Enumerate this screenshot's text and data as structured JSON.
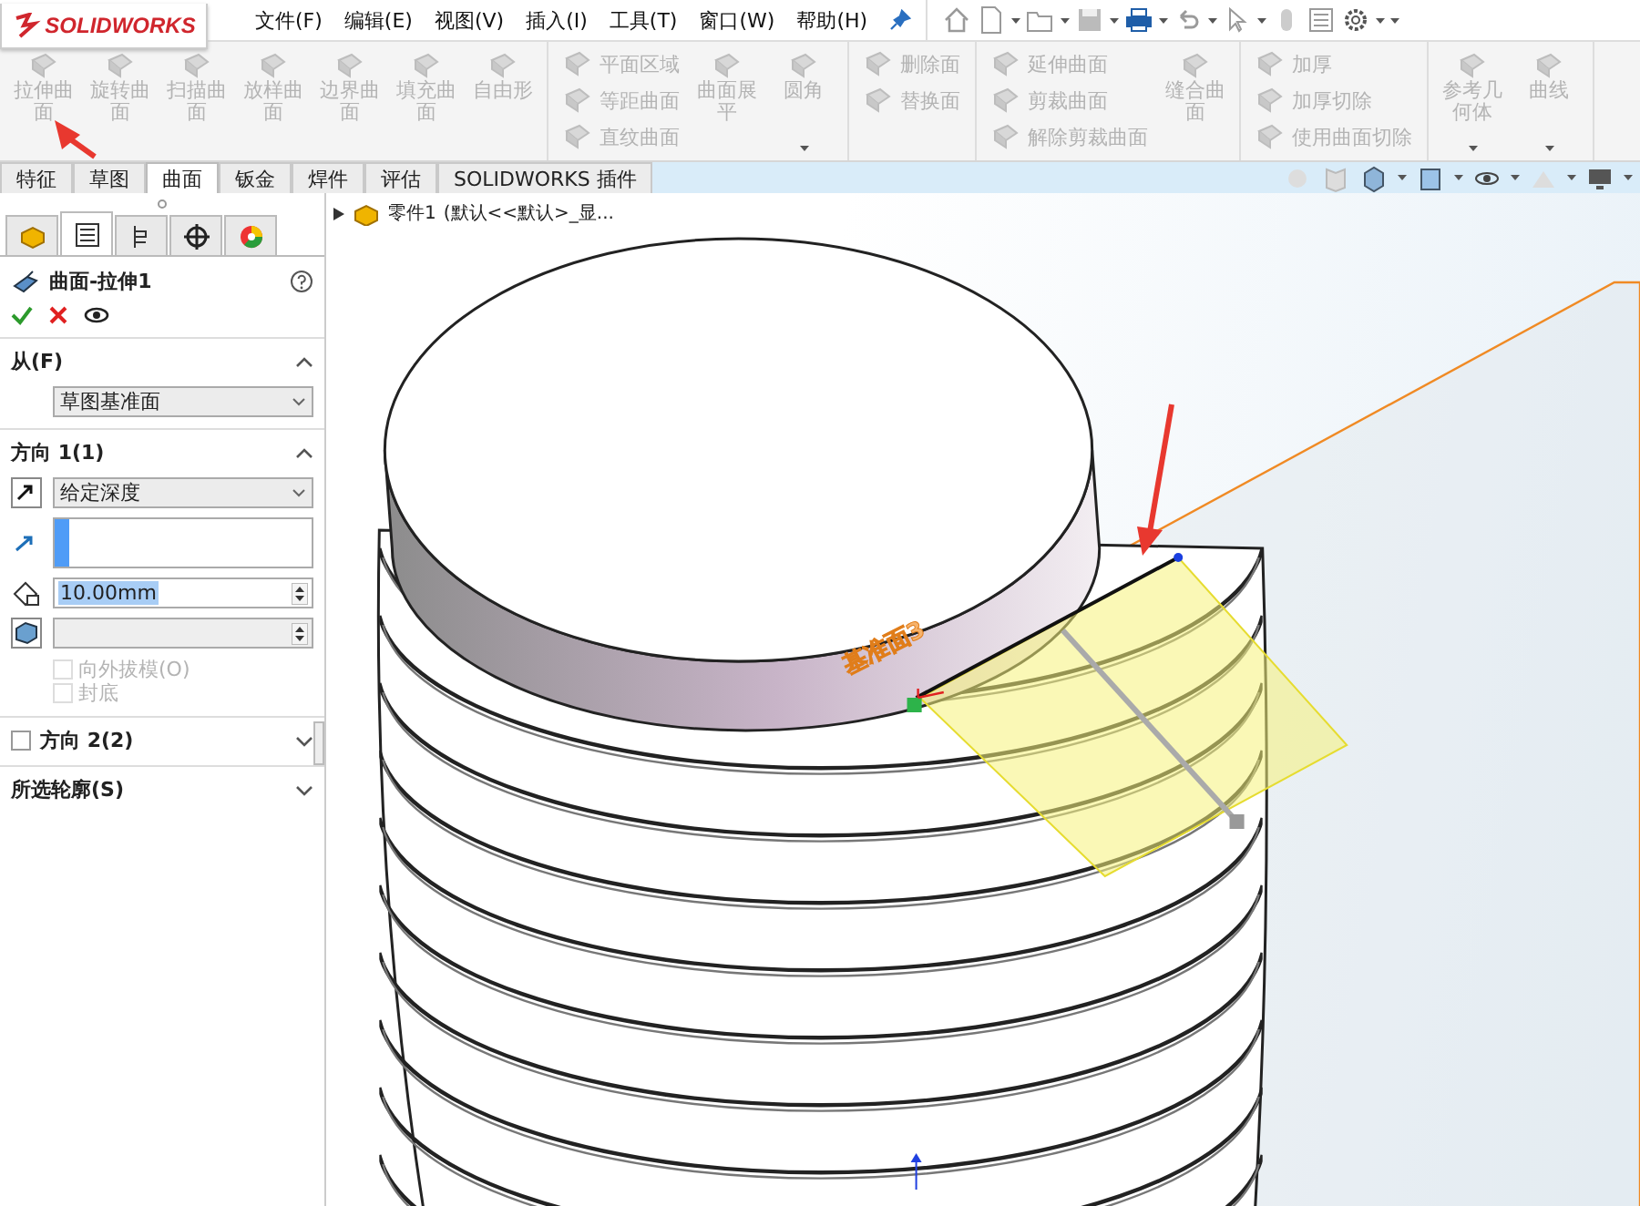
{
  "title_bar": {
    "logo": "SOLIDWORKS",
    "menu": [
      {
        "label": "文件(F)"
      },
      {
        "label": "编辑(E)"
      },
      {
        "label": "视图(V)"
      },
      {
        "label": "插入(I)"
      },
      {
        "label": "工具(T)"
      },
      {
        "label": "窗口(W)"
      },
      {
        "label": "帮助(H)"
      }
    ]
  },
  "ribbon": {
    "groups": [
      {
        "columns": [
          {
            "kind": "large",
            "items": [
              {
                "label": "拉伸曲面",
                "disabled": true
              }
            ]
          },
          {
            "kind": "large",
            "items": [
              {
                "label": "旋转曲面",
                "disabled": true
              }
            ]
          },
          {
            "kind": "large",
            "items": [
              {
                "label": "扫描曲面",
                "disabled": true
              }
            ]
          },
          {
            "kind": "large",
            "items": [
              {
                "label": "放样曲面",
                "disabled": true
              }
            ]
          },
          {
            "kind": "large",
            "items": [
              {
                "label": "边界曲面",
                "disabled": true
              }
            ]
          },
          {
            "kind": "large",
            "items": [
              {
                "label": "填充曲面",
                "disabled": true
              }
            ]
          },
          {
            "kind": "large",
            "items": [
              {
                "label": "自由形",
                "disabled": true
              }
            ]
          }
        ]
      },
      {
        "columns": [
          {
            "kind": "stack",
            "items": [
              {
                "label": "平面区域",
                "disabled": true
              },
              {
                "label": "等距曲面",
                "disabled": true
              },
              {
                "label": "直纹曲面",
                "disabled": true
              }
            ]
          },
          {
            "kind": "large",
            "items": [
              {
                "label": "曲面展平",
                "disabled": true
              }
            ]
          },
          {
            "kind": "dropdown",
            "items": [
              {
                "label": "圆角",
                "disabled": true
              }
            ]
          }
        ]
      },
      {
        "columns": [
          {
            "kind": "stack",
            "items": [
              {
                "label": "删除面",
                "disabled": true
              },
              {
                "label": "替换面",
                "disabled": true
              }
            ]
          }
        ]
      },
      {
        "columns": [
          {
            "kind": "stack",
            "items": [
              {
                "label": "延伸曲面",
                "disabled": true
              },
              {
                "label": "剪裁曲面",
                "disabled": true
              },
              {
                "label": "解除剪裁曲面",
                "disabled": true
              }
            ]
          },
          {
            "kind": "large",
            "items": [
              {
                "label": "缝合曲面",
                "disabled": true
              }
            ]
          }
        ]
      },
      {
        "columns": [
          {
            "kind": "stack",
            "items": [
              {
                "label": "加厚",
                "disabled": true
              },
              {
                "label": "加厚切除",
                "disabled": true
              },
              {
                "label": "使用曲面切除",
                "disabled": true
              }
            ]
          }
        ]
      },
      {
        "columns": [
          {
            "kind": "dropdown",
            "items": [
              {
                "label": "参考几何体",
                "disabled": true
              }
            ]
          },
          {
            "kind": "dropdown",
            "items": [
              {
                "label": "曲线",
                "disabled": true
              }
            ]
          }
        ]
      }
    ]
  },
  "tabs": [
    {
      "label": "特征",
      "selected": false
    },
    {
      "label": "草图",
      "selected": false
    },
    {
      "label": "曲面",
      "selected": true
    },
    {
      "label": "钣金",
      "selected": false
    },
    {
      "label": "焊件",
      "selected": false
    },
    {
      "label": "评估",
      "selected": false
    },
    {
      "label": "SOLIDWORKS 插件",
      "selected": false
    }
  ],
  "panel": {
    "tabs": [
      {
        "selected": false
      },
      {
        "selected": true
      },
      {
        "selected": false
      },
      {
        "selected": false
      },
      {
        "selected": false
      }
    ],
    "feature": {
      "title": "曲面-拉伸1"
    },
    "sections": [
      {
        "kind": "from",
        "title": "从(F)",
        "expanded": true,
        "select": "草图基准面"
      },
      {
        "kind": "direction",
        "title": "方向 1(1)",
        "expanded": true,
        "end_condition": "给定深度",
        "depth": {
          "value": "10.00mm",
          "highlighted": true
        },
        "options": [
          {
            "label": "向外拔模(O)",
            "checked": false,
            "disabled": true
          },
          {
            "label": "封底",
            "checked": false,
            "disabled": true
          }
        ]
      },
      {
        "kind": "check",
        "title": "方向 2(2)",
        "checked": false,
        "expanded": false
      },
      {
        "kind": "plain",
        "title": "所选轮廓(S)",
        "expanded": false
      }
    ]
  },
  "viewport": {
    "tree": {
      "name": "零件1",
      "config": "(默认<<默认>_显..."
    },
    "plane_label": "基准面3"
  }
}
